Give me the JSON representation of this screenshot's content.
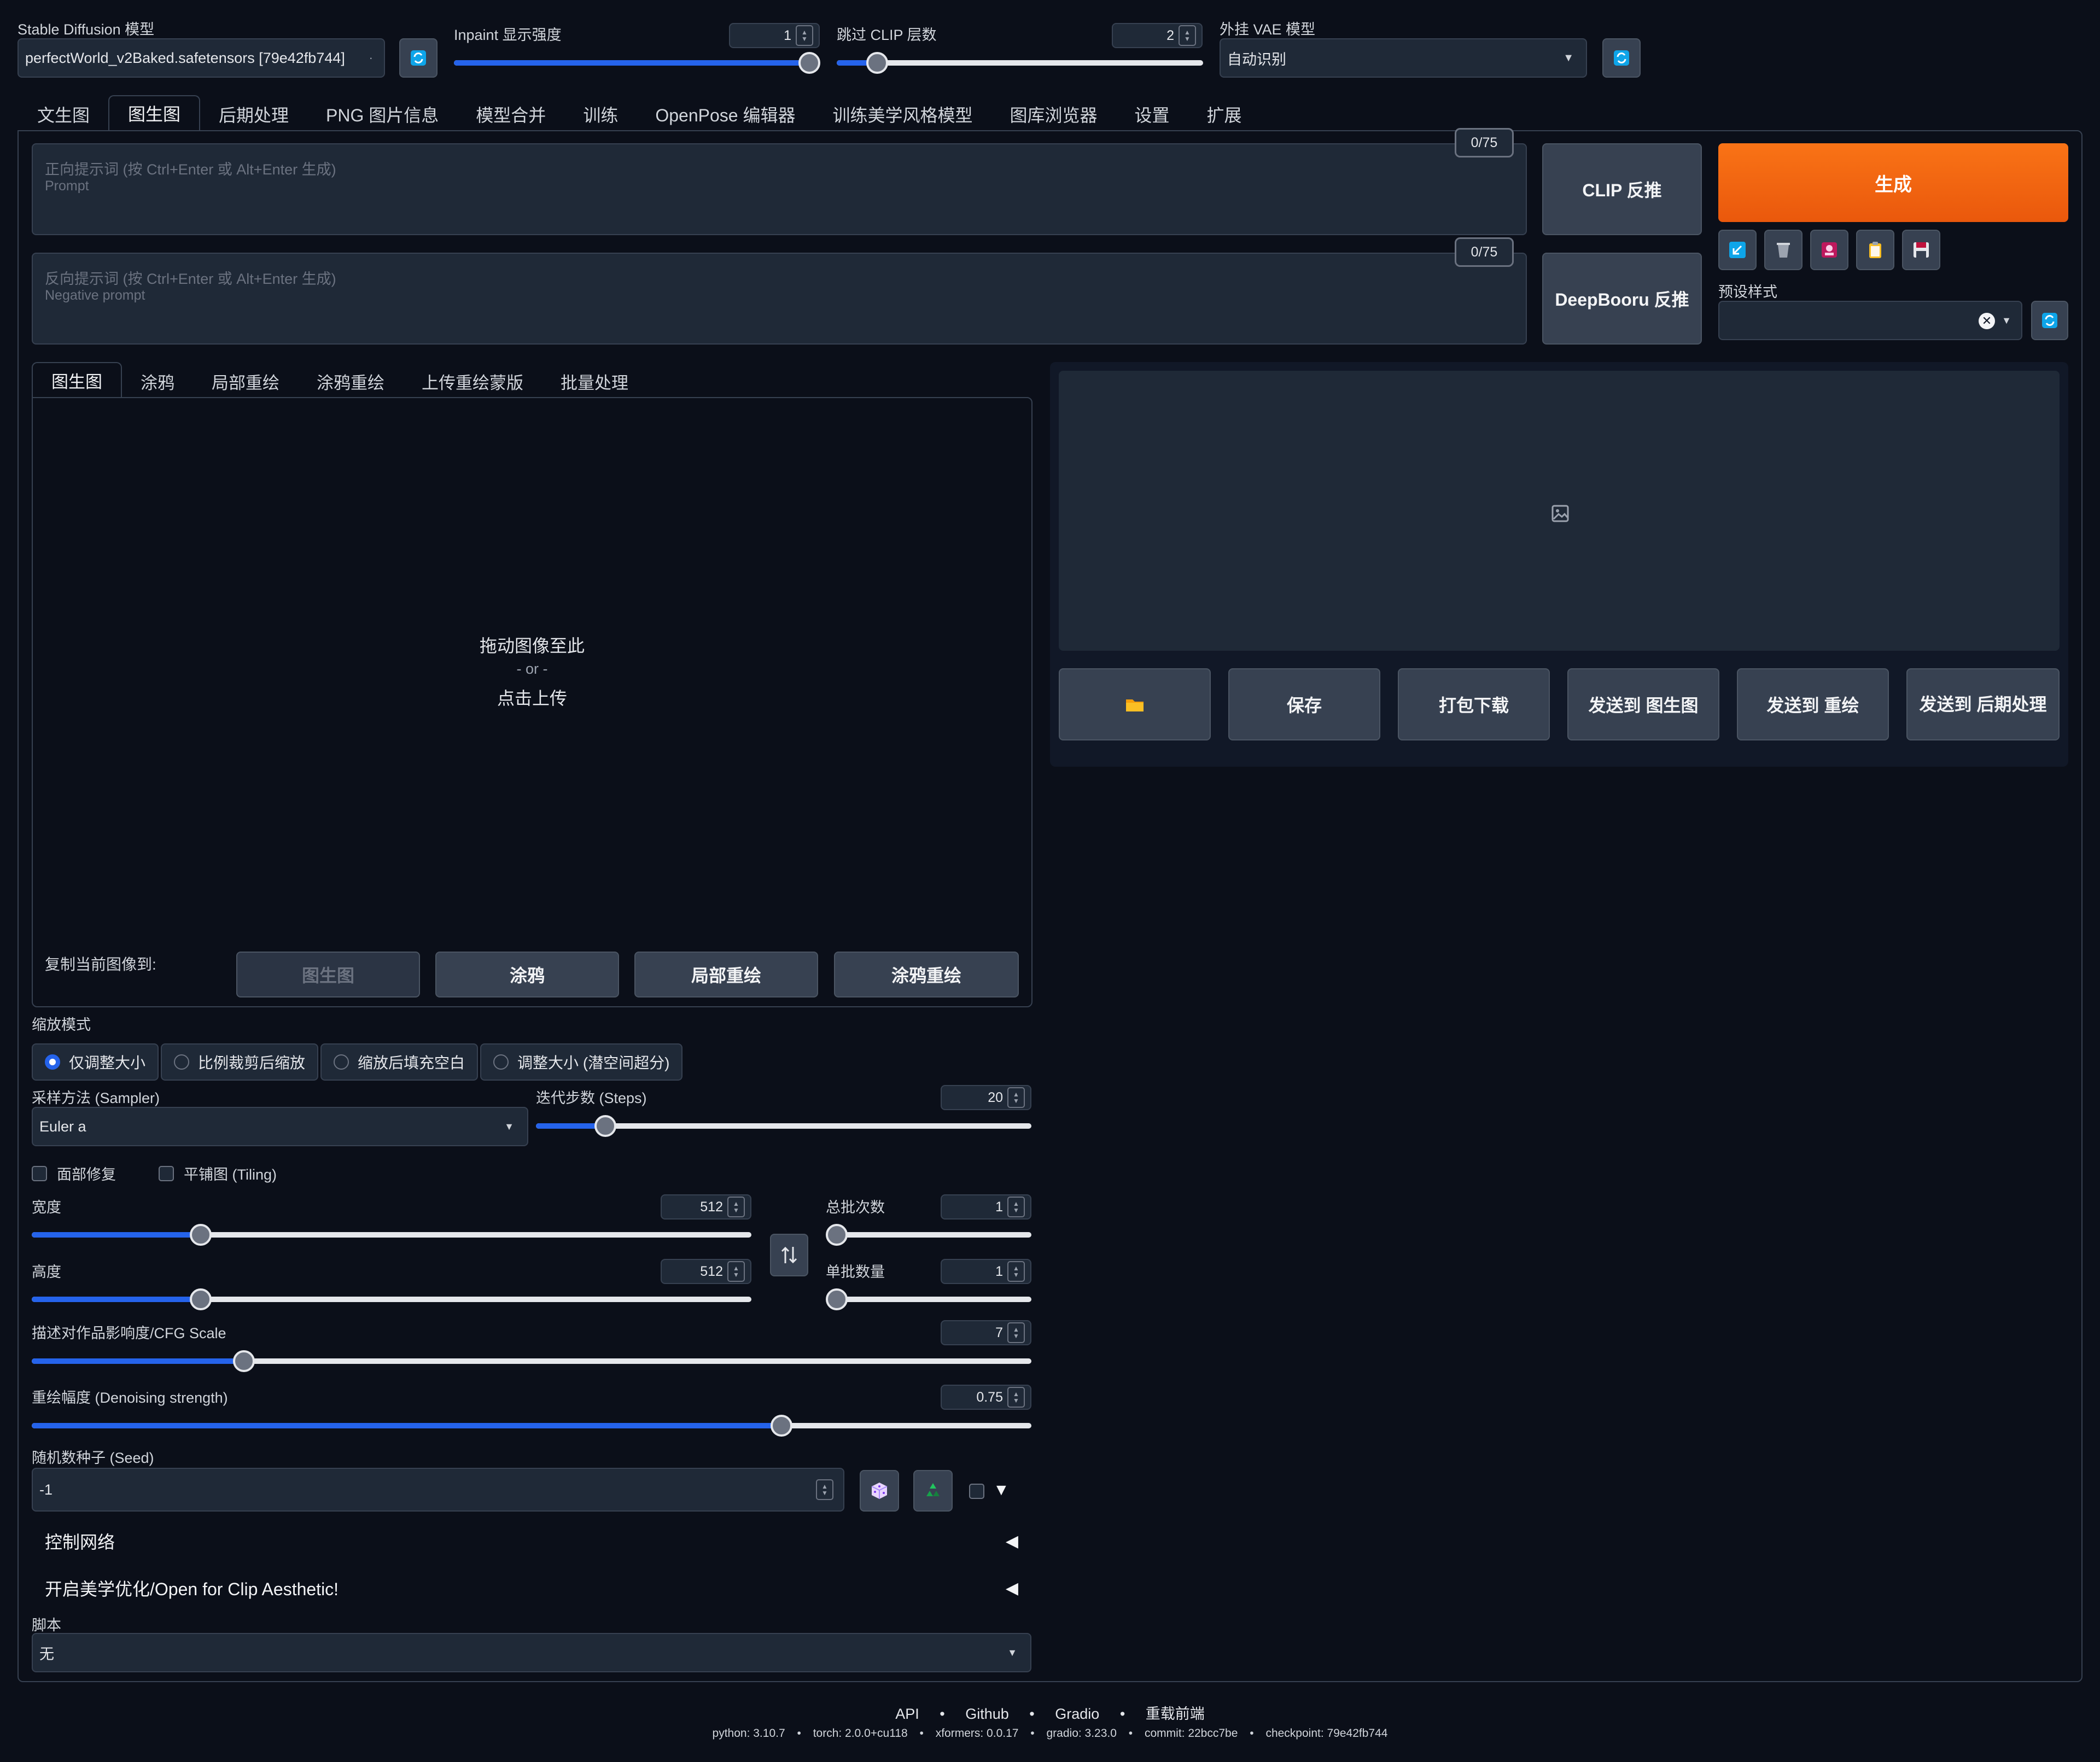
{
  "top": {
    "sd_model_label": "Stable Diffusion 模型",
    "sd_model_value": "perfectWorld_v2Baked.safetensors [79e42fb744]",
    "inpaint_label": "Inpaint 显示强度",
    "inpaint_value": "1",
    "inpaint_fraction": 1.0,
    "clip_skip_label": "跳过 CLIP 层数",
    "clip_skip_value": "2",
    "clip_skip_fraction": 0.11,
    "vae_label": "外挂 VAE 模型",
    "vae_value": "自动识别"
  },
  "main_tabs": [
    "文生图",
    "图生图",
    "后期处理",
    "PNG 图片信息",
    "模型合并",
    "训练",
    "OpenPose 编辑器",
    "训练美学风格模型",
    "图库浏览器",
    "设置",
    "扩展"
  ],
  "prompt": {
    "positive_placeholder": "正向提示词 (按 Ctrl+Enter 或 Alt+Enter 生成)",
    "positive_sub": "Prompt",
    "positive_count": "0/75",
    "negative_placeholder": "反向提示词 (按 Ctrl+Enter 或 Alt+Enter 生成)",
    "negative_sub": "Negative prompt",
    "negative_count": "0/75"
  },
  "buttons": {
    "clip_interrogate": "CLIP 反推",
    "deepbooru": "DeepBooru 反推",
    "generate": "生成",
    "preset_label": "预设样式"
  },
  "img_tabs": [
    "图生图",
    "涂鸦",
    "局部重绘",
    "涂鸦重绘",
    "上传重绘蒙版",
    "批量处理"
  ],
  "upload": {
    "line1": "拖动图像至此",
    "line2": "- or -",
    "line3": "点击上传"
  },
  "copy_to": {
    "label": "复制当前图像到:",
    "buttons": [
      "图生图",
      "涂鸦",
      "局部重绘",
      "涂鸦重绘"
    ]
  },
  "output_buttons": [
    "保存",
    "打包下载",
    "发送到 图生图",
    "发送到 重绘",
    "发送到 后期处理"
  ],
  "resize": {
    "label": "缩放模式",
    "options": [
      "仅调整大小",
      "比例裁剪后缩放",
      "缩放后填充空白",
      "调整大小 (潜空间超分)"
    ],
    "selected": "仅调整大小"
  },
  "sampler": {
    "label": "采样方法 (Sampler)",
    "value": "Euler a"
  },
  "steps": {
    "label": "迭代步数 (Steps)",
    "value": "20",
    "fraction": 0.14
  },
  "checks": {
    "face": "面部修复",
    "tiling": "平铺图 (Tiling)"
  },
  "width": {
    "label": "宽度",
    "value": "512",
    "fraction": 0.235
  },
  "height": {
    "label": "高度",
    "value": "512",
    "fraction": 0.235
  },
  "batch_count": {
    "label": "总批次数",
    "value": "1",
    "fraction": 0.0
  },
  "batch_size": {
    "label": "单批数量",
    "value": "1",
    "fraction": 0.0
  },
  "cfg": {
    "label": "描述对作品影响度/CFG Scale",
    "value": "7",
    "fraction": 0.212
  },
  "denoise": {
    "label": "重绘幅度 (Denoising strength)",
    "value": "0.75",
    "fraction": 0.75
  },
  "seed": {
    "label": "随机数种子 (Seed)",
    "value": "-1"
  },
  "accordions": [
    "控制网络",
    "开启美学优化/Open for Clip Aesthetic!"
  ],
  "script": {
    "label": "脚本",
    "value": "无"
  },
  "footer": {
    "links": [
      "API",
      "Github",
      "Gradio",
      "重载前端"
    ],
    "versions": [
      "python: 3.10.7",
      "torch: 2.0.0+cu118",
      "xformers: 0.0.17",
      "gradio: 3.23.0",
      "commit: 22bcc7be",
      "checkpoint: 79e42fb744"
    ]
  }
}
